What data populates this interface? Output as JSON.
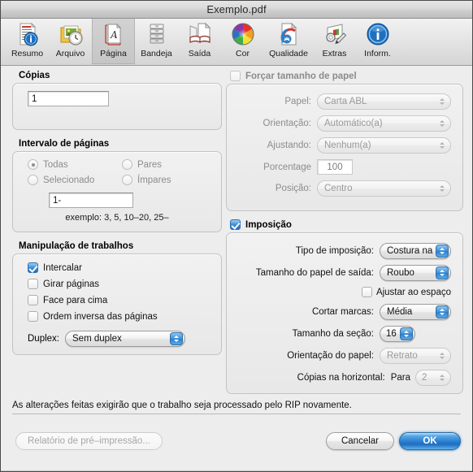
{
  "window": {
    "title": "Exemplo.pdf"
  },
  "toolbar": {
    "items": [
      {
        "label": "Resumo",
        "icon": "summary-icon",
        "selected": false
      },
      {
        "label": "Arquivo",
        "icon": "file-icon",
        "selected": false
      },
      {
        "label": "Página",
        "icon": "page-icon",
        "selected": true
      },
      {
        "label": "Bandeja",
        "icon": "tray-icon",
        "selected": false
      },
      {
        "label": "Saída",
        "icon": "output-icon",
        "selected": false
      },
      {
        "label": "Cor",
        "icon": "color-wheel-icon",
        "selected": false
      },
      {
        "label": "Qualidade",
        "icon": "quality-icon",
        "selected": false
      },
      {
        "label": "Extras",
        "icon": "extras-icon",
        "selected": false
      },
      {
        "label": "Inform.",
        "icon": "info-icon",
        "selected": false
      }
    ]
  },
  "copies": {
    "title": "Cópias",
    "value": "1"
  },
  "page_range": {
    "title": "Intervalo de páginas",
    "enabled": false,
    "options": [
      {
        "label": "Todas",
        "selected": true
      },
      {
        "label": "Pares",
        "selected": false
      },
      {
        "label": "Selecionado",
        "selected": false
      },
      {
        "label": "Ímpares",
        "selected": false
      }
    ],
    "range_value": "1-",
    "example": "exemplo: 3, 5, 10–20, 25–"
  },
  "job_handling": {
    "title": "Manipulação de trabalhos",
    "checkboxes": [
      {
        "label": "Intercalar",
        "checked": true
      },
      {
        "label": "Girar páginas",
        "checked": false
      },
      {
        "label": "Face para cima",
        "checked": false
      },
      {
        "label": "Ordem inversa das páginas",
        "checked": false
      }
    ],
    "duplex_label": "Duplex:",
    "duplex_value": "Sem duplex"
  },
  "force_paper": {
    "title": "Forçar tamanho de papel",
    "checked": false,
    "enabled": false,
    "rows": [
      {
        "label": "Papel:",
        "value": "Carta ABL"
      },
      {
        "label": "Orientação:",
        "value": "Automático(a)"
      },
      {
        "label": "Ajustando:",
        "value": "Nenhum(a)"
      }
    ],
    "percentage_label": "Porcentage",
    "percentage_value": "100",
    "position_label": "Posição:",
    "position_value": "Centro"
  },
  "imposition": {
    "title": "Imposição",
    "checked": true,
    "type_label": "Tipo de imposição:",
    "type_value": "Costura na",
    "paper_size_label": "Tamanho do papel de saída:",
    "paper_size_value": "Roubo",
    "fit_label": "Ajustar ao espaço",
    "fit_checked": false,
    "crop_label": "Cortar marcas:",
    "crop_value": "Média",
    "section_label": "Tamanho da seção:",
    "section_value": "16",
    "orientation_label": "Orientação do papel:",
    "orientation_value": "Retrato",
    "horizontal_label": "Cópias na horizontal:",
    "horizontal_prefix": "Para",
    "horizontal_value": "2"
  },
  "footer": {
    "note": "As alterações feitas exigirão que o trabalho seja processado pelo RIP novamente.",
    "report_button": "Relatório de pré–impressão...",
    "cancel_button": "Cancelar",
    "ok_button": "OK"
  }
}
